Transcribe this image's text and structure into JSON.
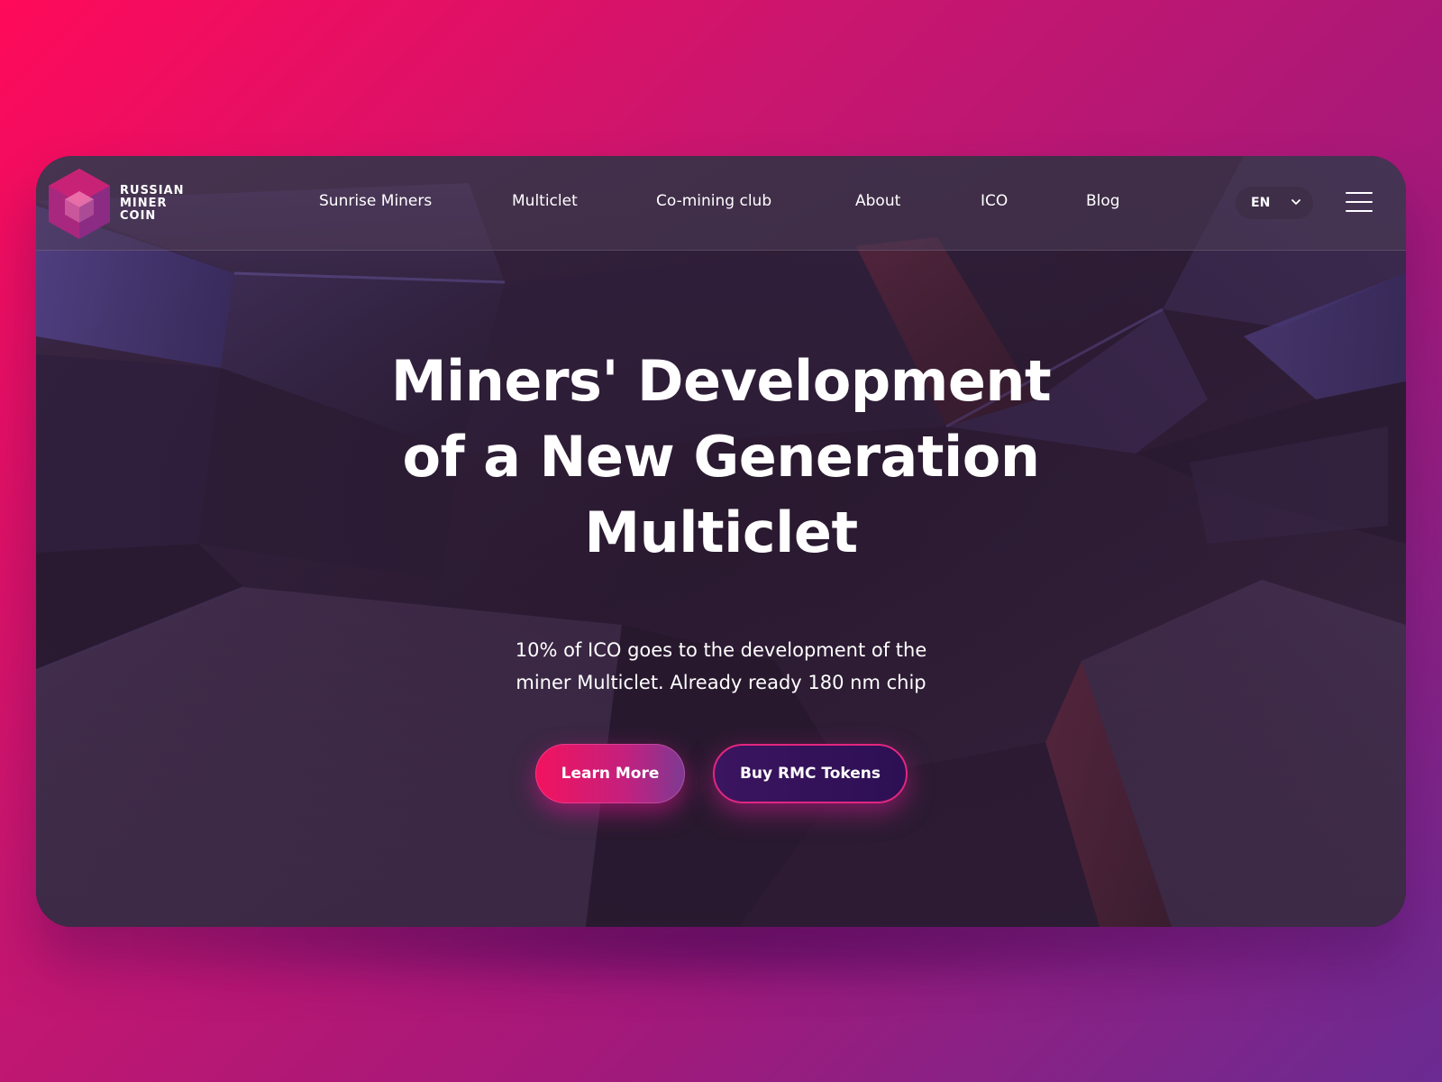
{
  "brand": {
    "name_line1": "RUSSIAN",
    "name_line2": "MINER",
    "name_line3": "COIN"
  },
  "nav": {
    "items": [
      {
        "label": "Sunrise Miners"
      },
      {
        "label": "Multiclet"
      },
      {
        "label": "Co-mining club"
      },
      {
        "label": "About"
      },
      {
        "label": "ICO"
      },
      {
        "label": "Blog"
      }
    ],
    "language": "EN"
  },
  "hero": {
    "title_line1": "Miners' Development",
    "title_line2": "of a New Generation",
    "title_line3": "Multiclet",
    "subtitle_line1": "10% of ICO goes to the development of the",
    "subtitle_line2": "miner Multiclet. Already ready 180 nm chip"
  },
  "buttons": {
    "learn_more": "Learn More",
    "buy_tokens": "Buy RMC Tokens"
  },
  "icons": {
    "logo": "hexagon-cube-logo-icon",
    "language_chevron": "chevron-down-icon",
    "menu": "hamburger-menu-icon"
  },
  "colors": {
    "accent_pink": "#f2135e",
    "accent_purple": "#6a2b92",
    "card_dark": "#3a2642",
    "text": "#ffffff"
  }
}
